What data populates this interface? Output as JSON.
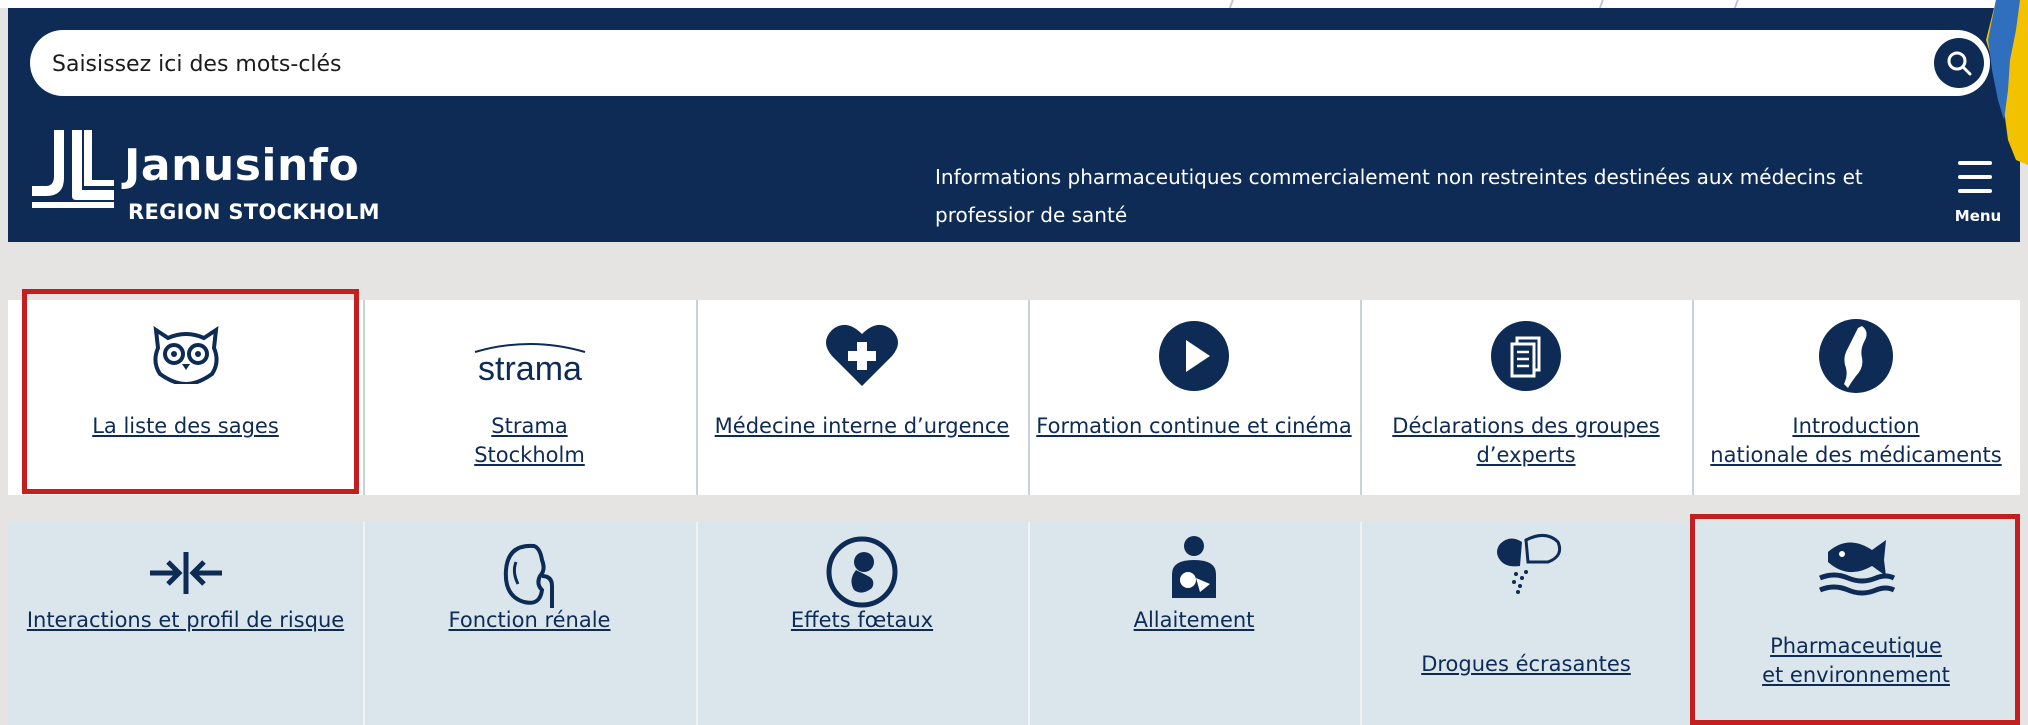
{
  "search": {
    "placeholder": "Saisissez ici des mots-clés"
  },
  "header": {
    "logo_title": "Janusinfo",
    "logo_subtitle": "REGION STOCKHOLM",
    "tagline": "Informations pharmaceutiques commercialement non restreintes destinées aux médecins et professior de santé",
    "menu_label": "Menu"
  },
  "row1": [
    {
      "label": "La liste des sages",
      "icon": "owl-icon"
    },
    {
      "label_line1": "Strama",
      "label_line2": "Stockholm",
      "icon_text": "strama",
      "icon": "strama-logo-icon"
    },
    {
      "label": "Médecine interne d’urgence",
      "icon": "heart-plus-icon"
    },
    {
      "label": "Formation continue et cinéma",
      "icon": "play-icon"
    },
    {
      "label_line1": "Déclarations des groupes",
      "label_line2": "d’experts",
      "icon": "document-icon"
    },
    {
      "label_line1": "Introduction",
      "label_line2": "nationale des médicaments",
      "icon": "sweden-map-icon"
    }
  ],
  "row2": [
    {
      "label": "Interactions et profil de risque",
      "icon": "arrows-inward-icon"
    },
    {
      "label": "Fonction rénale",
      "icon": "kidney-icon"
    },
    {
      "label": "Effets fœtaux",
      "icon": "fetus-icon"
    },
    {
      "label": "Allaitement",
      "icon": "breastfeeding-icon"
    },
    {
      "label": "Drogues écrasantes",
      "icon": "crushed-pill-icon"
    },
    {
      "label_line1": "Pharmaceutique",
      "label_line2": "et environnement",
      "icon": "fish-water-icon"
    }
  ],
  "colors": {
    "navy": "#0d2b55",
    "highlight": "#c41e1e",
    "row2_bg": "#dbe6ec"
  }
}
